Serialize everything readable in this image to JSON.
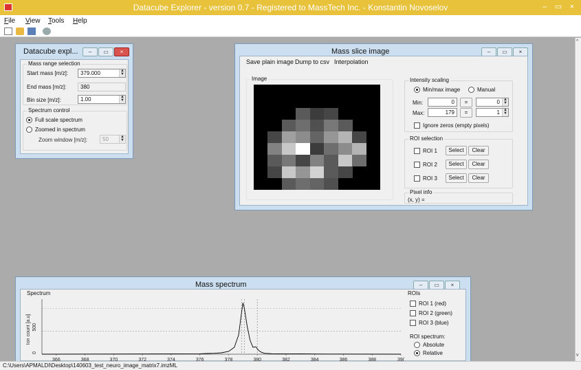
{
  "app": {
    "title": "Datacube Explorer - version 0.7 - Registered to MassTech Inc. - Konstantin Novoselov",
    "window_buttons": [
      "–",
      "▭",
      "×"
    ],
    "menu": [
      "File",
      "View",
      "Tools",
      "Help"
    ],
    "toolbar_icons": [
      "new-file-icon",
      "open-folder-icon",
      "save-icon",
      "disc-icon"
    ],
    "status_path": "C:\\Users\\APMALDI\\Desktop\\140603_test_neuro_image_matrix7.imzML"
  },
  "explorer": {
    "title": "Datacube expl...",
    "range_group": "Mass range selection",
    "start_label": "Start mass [m/z]:",
    "start_value": "379.000",
    "end_label": "End mass [m/z]:",
    "end_value": "380",
    "bin_label": "Bin size [m/z]:",
    "bin_value": "1.00",
    "spectrum_group": "Spectrum control",
    "full_scale": "Full scale spectrum",
    "zoomed": "Zoomed in spectrum",
    "zoom_label": "Zoom window [m/z]:",
    "zoom_value": "50"
  },
  "slice": {
    "title": "Mass slice image",
    "menu": [
      "Save plain image",
      "Dump to csv",
      "Interpolation"
    ],
    "image_group": "Image",
    "intensity_group": "Intensity scaling",
    "minmax": "Min/max image",
    "manual": "Manual",
    "min_label": "Min:",
    "min_value": "0",
    "min_right": "0",
    "max_label": "Max:",
    "max_value": "179",
    "max_right": "1",
    "eq_button": "=",
    "ignore_zeros": "Ignore zeros (empty pixels)",
    "roi_group": "ROI selection",
    "rois": [
      "ROI 1",
      "ROI 2",
      "ROI 3"
    ],
    "select_label": "Select",
    "clear_label": "Clear",
    "pixel_group": "Pixel info",
    "pixel_text": "(x, y) ="
  },
  "spectrum": {
    "title": "Mass spectrum",
    "plot_group": "Spectrum",
    "rois_group": "ROIs",
    "roi_items": [
      "ROI 1 (red)",
      "ROI 2 (green)",
      "ROI 3 (blue)"
    ],
    "roi_spectrum_label": "ROI spectrum:",
    "absolute": "Absolute",
    "relative": "Relative"
  },
  "chart_data": {
    "type": "line",
    "title": "",
    "xlabel": "",
    "ylabel": "Ion count [a.u]",
    "x_ticks": [
      "366",
      "368",
      "370",
      "372",
      "374",
      "376",
      "378",
      "380",
      "382",
      "384",
      "386",
      "388",
      "39("
    ],
    "y_ticks": [
      "0",
      "500"
    ],
    "xlim": [
      365,
      390
    ],
    "ylim": [
      0,
      1200
    ],
    "x": [
      365,
      376,
      376.5,
      377,
      377.5,
      378,
      378.4,
      378.7,
      378.9,
      379.0,
      379.1,
      379.3,
      379.5,
      379.7,
      379.9,
      380.1,
      380.3,
      380.5,
      381,
      382,
      383,
      384,
      385,
      390
    ],
    "y": [
      0,
      8,
      15,
      20,
      30,
      60,
      150,
      420,
      900,
      1120,
      1000,
      600,
      300,
      150,
      160,
      80,
      40,
      20,
      10,
      6,
      8,
      5,
      3,
      0
    ],
    "markers_x": [
      378.9,
      379.1,
      380
    ],
    "series_color": "#000000",
    "grid": true
  },
  "heatmap": {
    "cols": 9,
    "rows": 9,
    "cells": [
      [
        0,
        0,
        0,
        0,
        0,
        0,
        0,
        0,
        0
      ],
      [
        0,
        0,
        0,
        0,
        0,
        0,
        0,
        0,
        0
      ],
      [
        0,
        0,
        0,
        90,
        60,
        70,
        0,
        0,
        0
      ],
      [
        0,
        0,
        90,
        110,
        80,
        120,
        90,
        0,
        0
      ],
      [
        0,
        70,
        160,
        140,
        100,
        150,
        180,
        70,
        0
      ],
      [
        0,
        130,
        200,
        255,
        60,
        110,
        140,
        180,
        0
      ],
      [
        0,
        90,
        120,
        70,
        130,
        90,
        200,
        110,
        0
      ],
      [
        0,
        70,
        200,
        150,
        210,
        90,
        70,
        0,
        0
      ],
      [
        0,
        0,
        90,
        110,
        100,
        80,
        0,
        0,
        0
      ]
    ]
  }
}
